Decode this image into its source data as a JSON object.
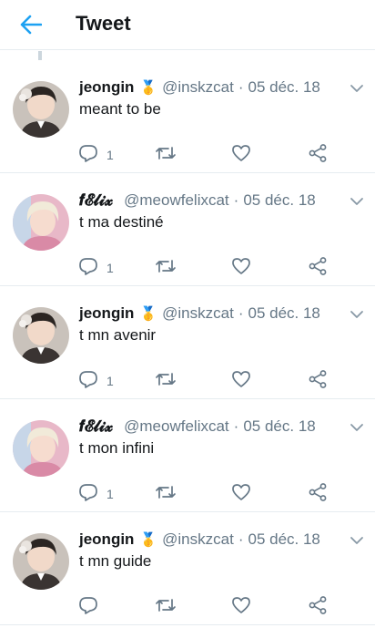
{
  "header": {
    "title": "Tweet",
    "back_icon": "arrow-left-icon",
    "accent": "#1da1f2"
  },
  "tweets": [
    {
      "name": "jeongin",
      "badge": "🥇",
      "handle": "@inskzcat",
      "date": "05 déc. 18",
      "text": "meant to be",
      "reply_count": "1",
      "avatar": "jeongin"
    },
    {
      "name": "𝒇𝓔𝓵𝓲𝔁",
      "badge": "",
      "handle": "@meowfelixcat",
      "date": "05 déc. 18",
      "text": "t ma destiné",
      "reply_count": "1",
      "avatar": "felix"
    },
    {
      "name": "jeongin",
      "badge": "🥇",
      "handle": "@inskzcat",
      "date": "05 déc. 18",
      "text": "t mn avenir",
      "reply_count": "1",
      "avatar": "jeongin"
    },
    {
      "name": "𝒇𝓔𝓵𝓲𝔁",
      "badge": "",
      "handle": "@meowfelixcat",
      "date": "05 déc. 18",
      "text": "t mon infini",
      "reply_count": "1",
      "avatar": "felix"
    },
    {
      "name": "jeongin",
      "badge": "🥇",
      "handle": "@inskzcat",
      "date": "05 déc. 18",
      "text": "t mn guide",
      "reply_count": "",
      "avatar": "jeongin"
    }
  ],
  "separator": "·",
  "icons": {
    "reply": "reply-icon",
    "retweet": "retweet-icon",
    "like": "heart-icon",
    "share": "share-icon",
    "caret": "chevron-down-icon"
  }
}
